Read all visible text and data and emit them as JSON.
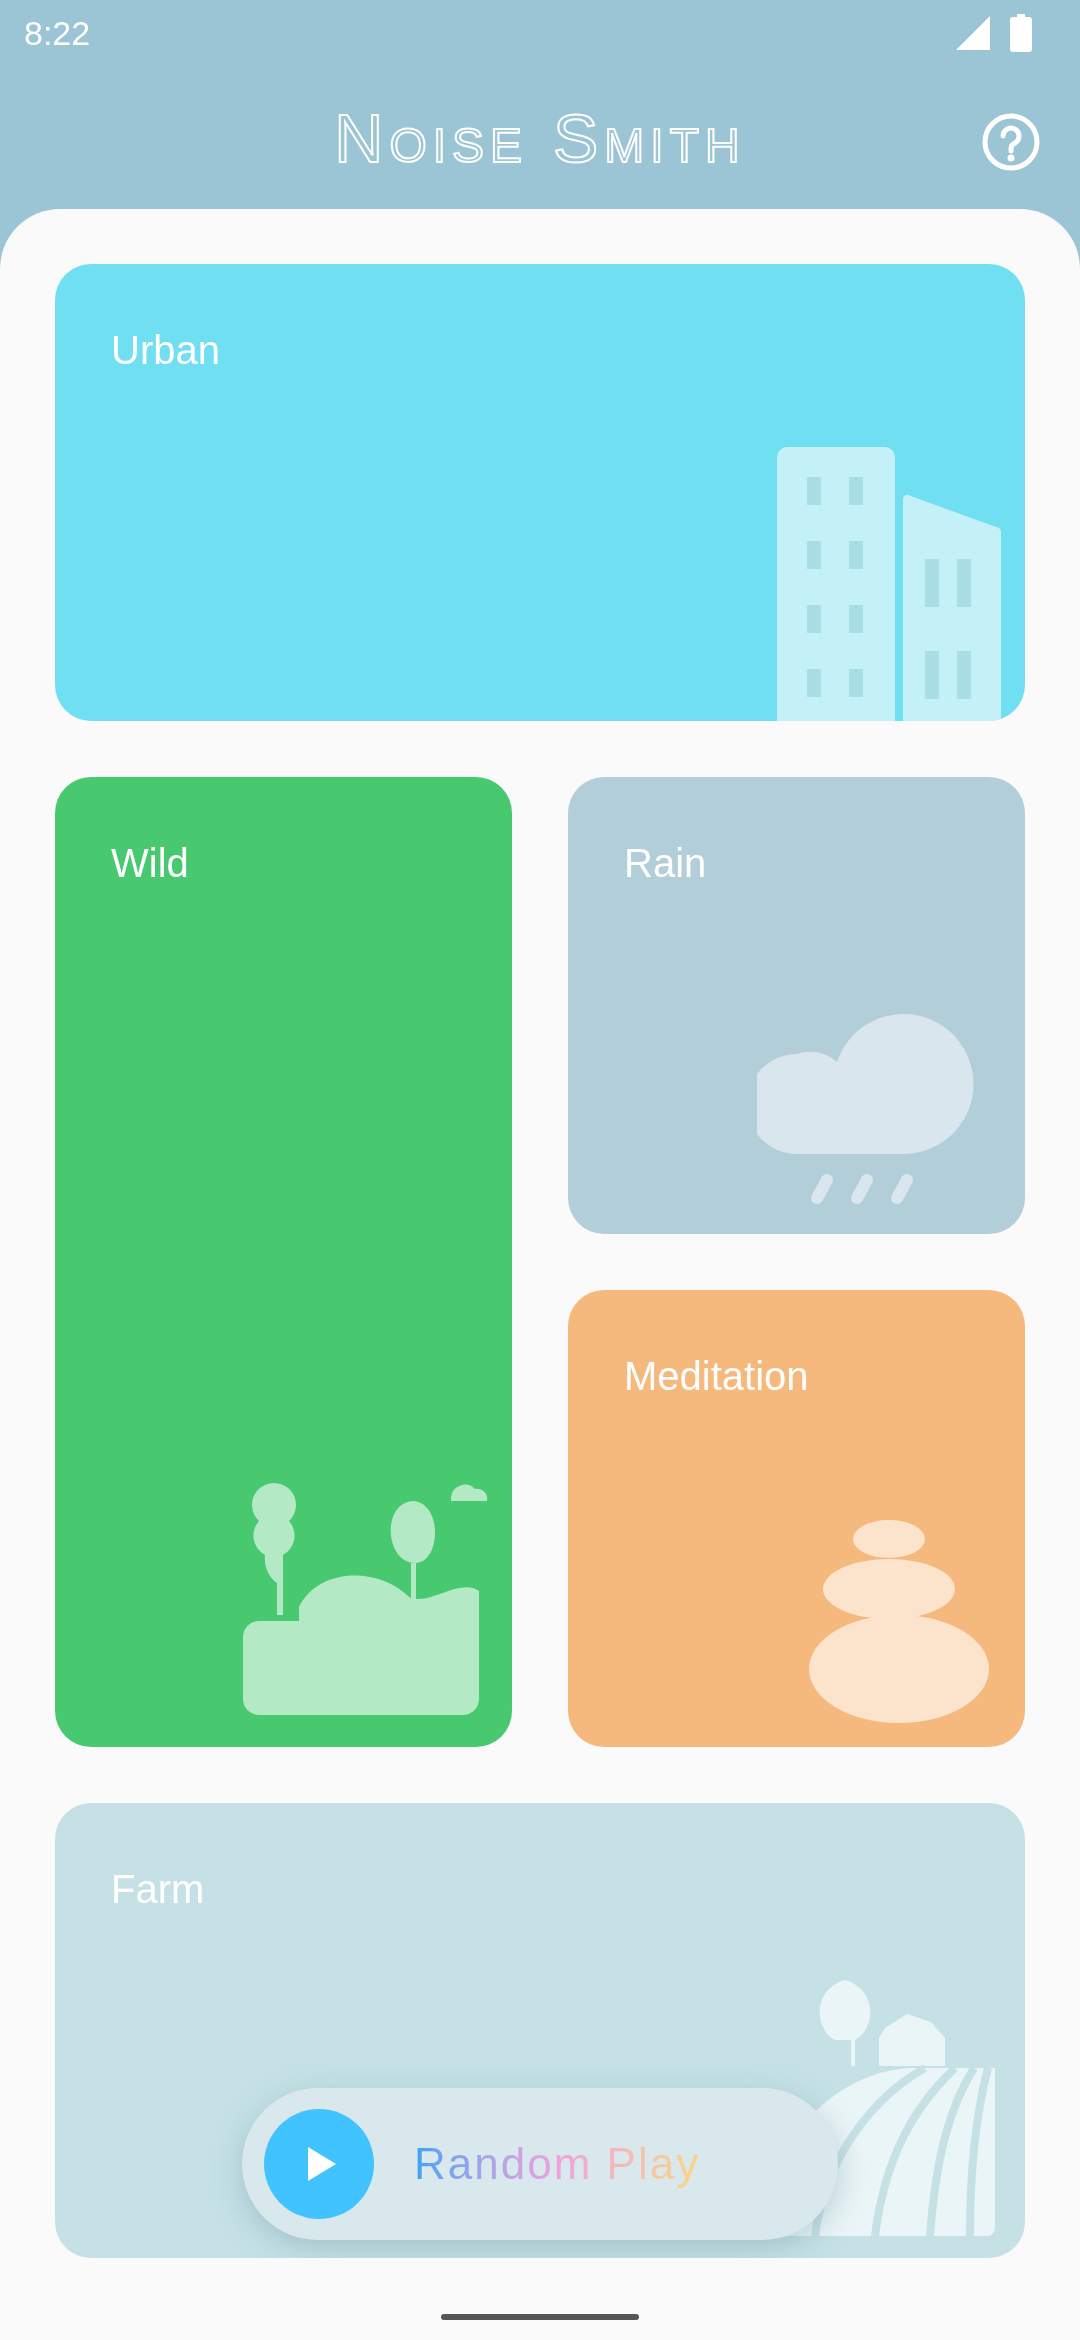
{
  "status_bar": {
    "time": "8:22"
  },
  "app_bar": {
    "title": "Noise Smith"
  },
  "categories": [
    {
      "label": "Urban",
      "kind": "urban",
      "color": "#6fdff1"
    },
    {
      "label": "Wild",
      "kind": "wild",
      "color": "#48c96f"
    },
    {
      "label": "Rain",
      "kind": "rain",
      "color": "#b2cfd9"
    },
    {
      "label": "Meditation",
      "kind": "meditation",
      "color": "#f5b97e"
    },
    {
      "label": "Farm",
      "kind": "farm",
      "color": "#c5e1e5"
    }
  ],
  "random_play": {
    "label": "Random Play"
  }
}
